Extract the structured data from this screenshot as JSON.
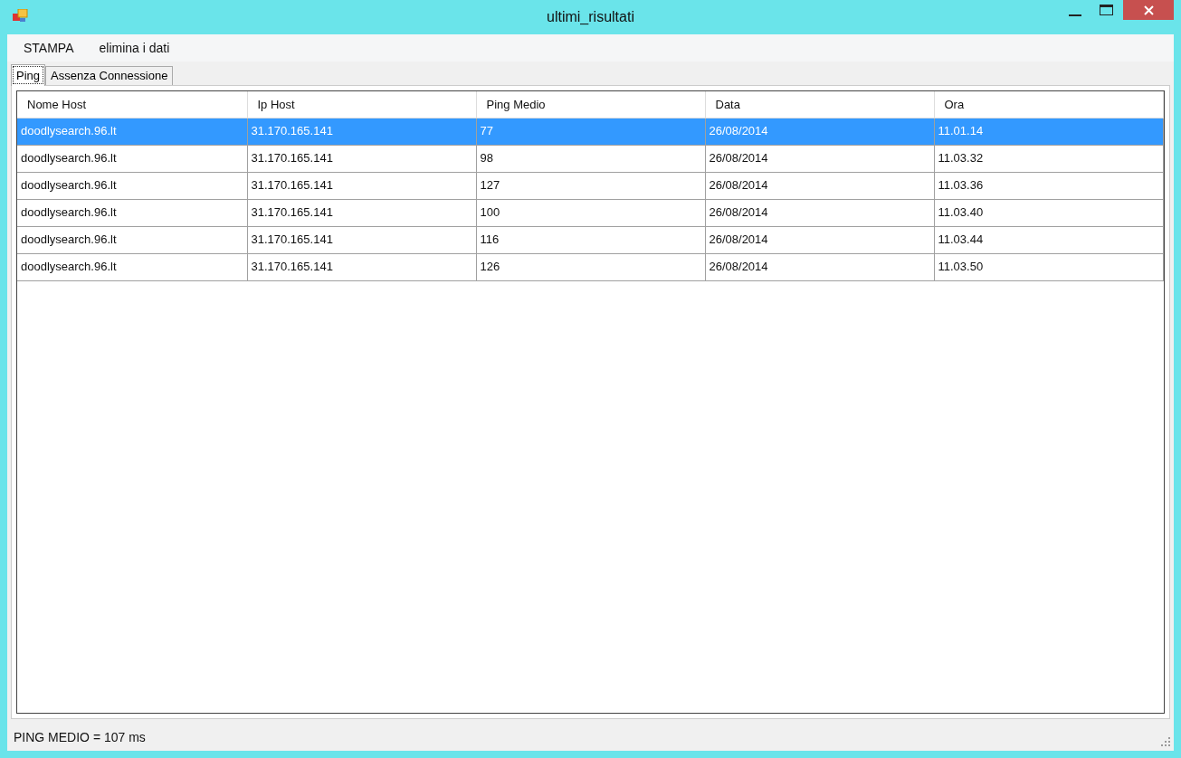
{
  "window": {
    "title": "ultimi_risultati"
  },
  "menu": [
    "STAMPA",
    "elimina i dati"
  ],
  "tabs": [
    {
      "label": "Ping",
      "selected": true
    },
    {
      "label": "Assenza Connessione",
      "selected": false
    }
  ],
  "table": {
    "columns": [
      "Nome Host",
      "Ip Host",
      "Ping Medio",
      "Data",
      "Ora"
    ],
    "rows": [
      {
        "cells": [
          "doodlysearch.96.lt",
          "31.170.165.141",
          "77",
          "26/08/2014",
          "11.01.14"
        ],
        "selected": true
      },
      {
        "cells": [
          "doodlysearch.96.lt",
          "31.170.165.141",
          "98",
          "26/08/2014",
          "11.03.32"
        ],
        "selected": false
      },
      {
        "cells": [
          "doodlysearch.96.lt",
          "31.170.165.141",
          "127",
          "26/08/2014",
          "11.03.36"
        ],
        "selected": false
      },
      {
        "cells": [
          "doodlysearch.96.lt",
          "31.170.165.141",
          "100",
          "26/08/2014",
          "11.03.40"
        ],
        "selected": false
      },
      {
        "cells": [
          "doodlysearch.96.lt",
          "31.170.165.141",
          "116",
          "26/08/2014",
          "11.03.44"
        ],
        "selected": false
      },
      {
        "cells": [
          "doodlysearch.96.lt",
          "31.170.165.141",
          "126",
          "26/08/2014",
          "11.03.50"
        ],
        "selected": false
      }
    ]
  },
  "status_bar": "PING MEDIO = 107 ms"
}
